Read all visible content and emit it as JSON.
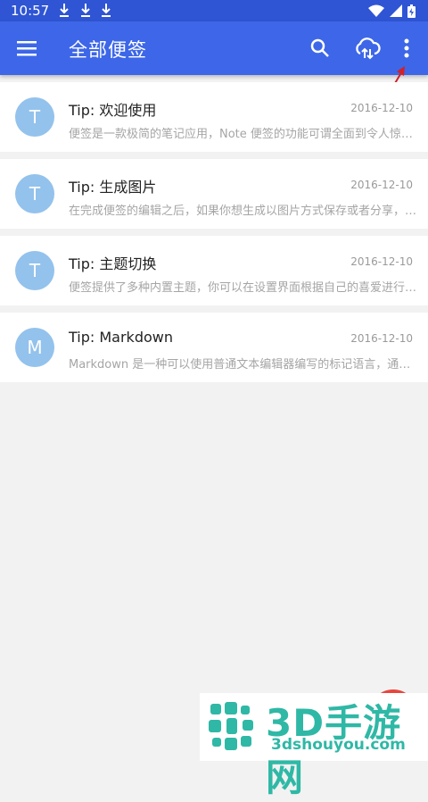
{
  "status_bar": {
    "time": "10:57"
  },
  "app_bar": {
    "title": "全部便签",
    "icons": [
      "menu-icon",
      "search-icon",
      "cloud-sync-icon",
      "more-vert-icon"
    ]
  },
  "notes": [
    {
      "avatar": "T",
      "title": "Tip: 欢迎使用",
      "date": "2016-12-10",
      "preview": "便签是一款极简的笔记应用，Note 便签的功能可谓全面到令人惊喜..."
    },
    {
      "avatar": "T",
      "title": "Tip: 生成图片",
      "date": "2016-12-10",
      "preview": "在完成便签的编辑之后，如果你想生成以图片方式保存或者分享，可..."
    },
    {
      "avatar": "T",
      "title": "Tip: 主题切换",
      "date": "2016-12-10",
      "preview": "便签提供了多种内置主题，你可以在设置界面根据自己的喜爱进行切..."
    },
    {
      "avatar": "M",
      "title": "Tip: Markdown",
      "date": "2016-12-10",
      "preview": "Markdown 是一种可以使用普通文本编辑器编写的标记语言，通过简..."
    }
  ],
  "watermark": {
    "brand": "3D手游网",
    "url": "3dshouyou.com"
  },
  "colors": {
    "status_bar": "#2f55d4",
    "app_bar": "#3d67e8",
    "avatar": "#93c2ec",
    "arrow": "#d0212b"
  }
}
